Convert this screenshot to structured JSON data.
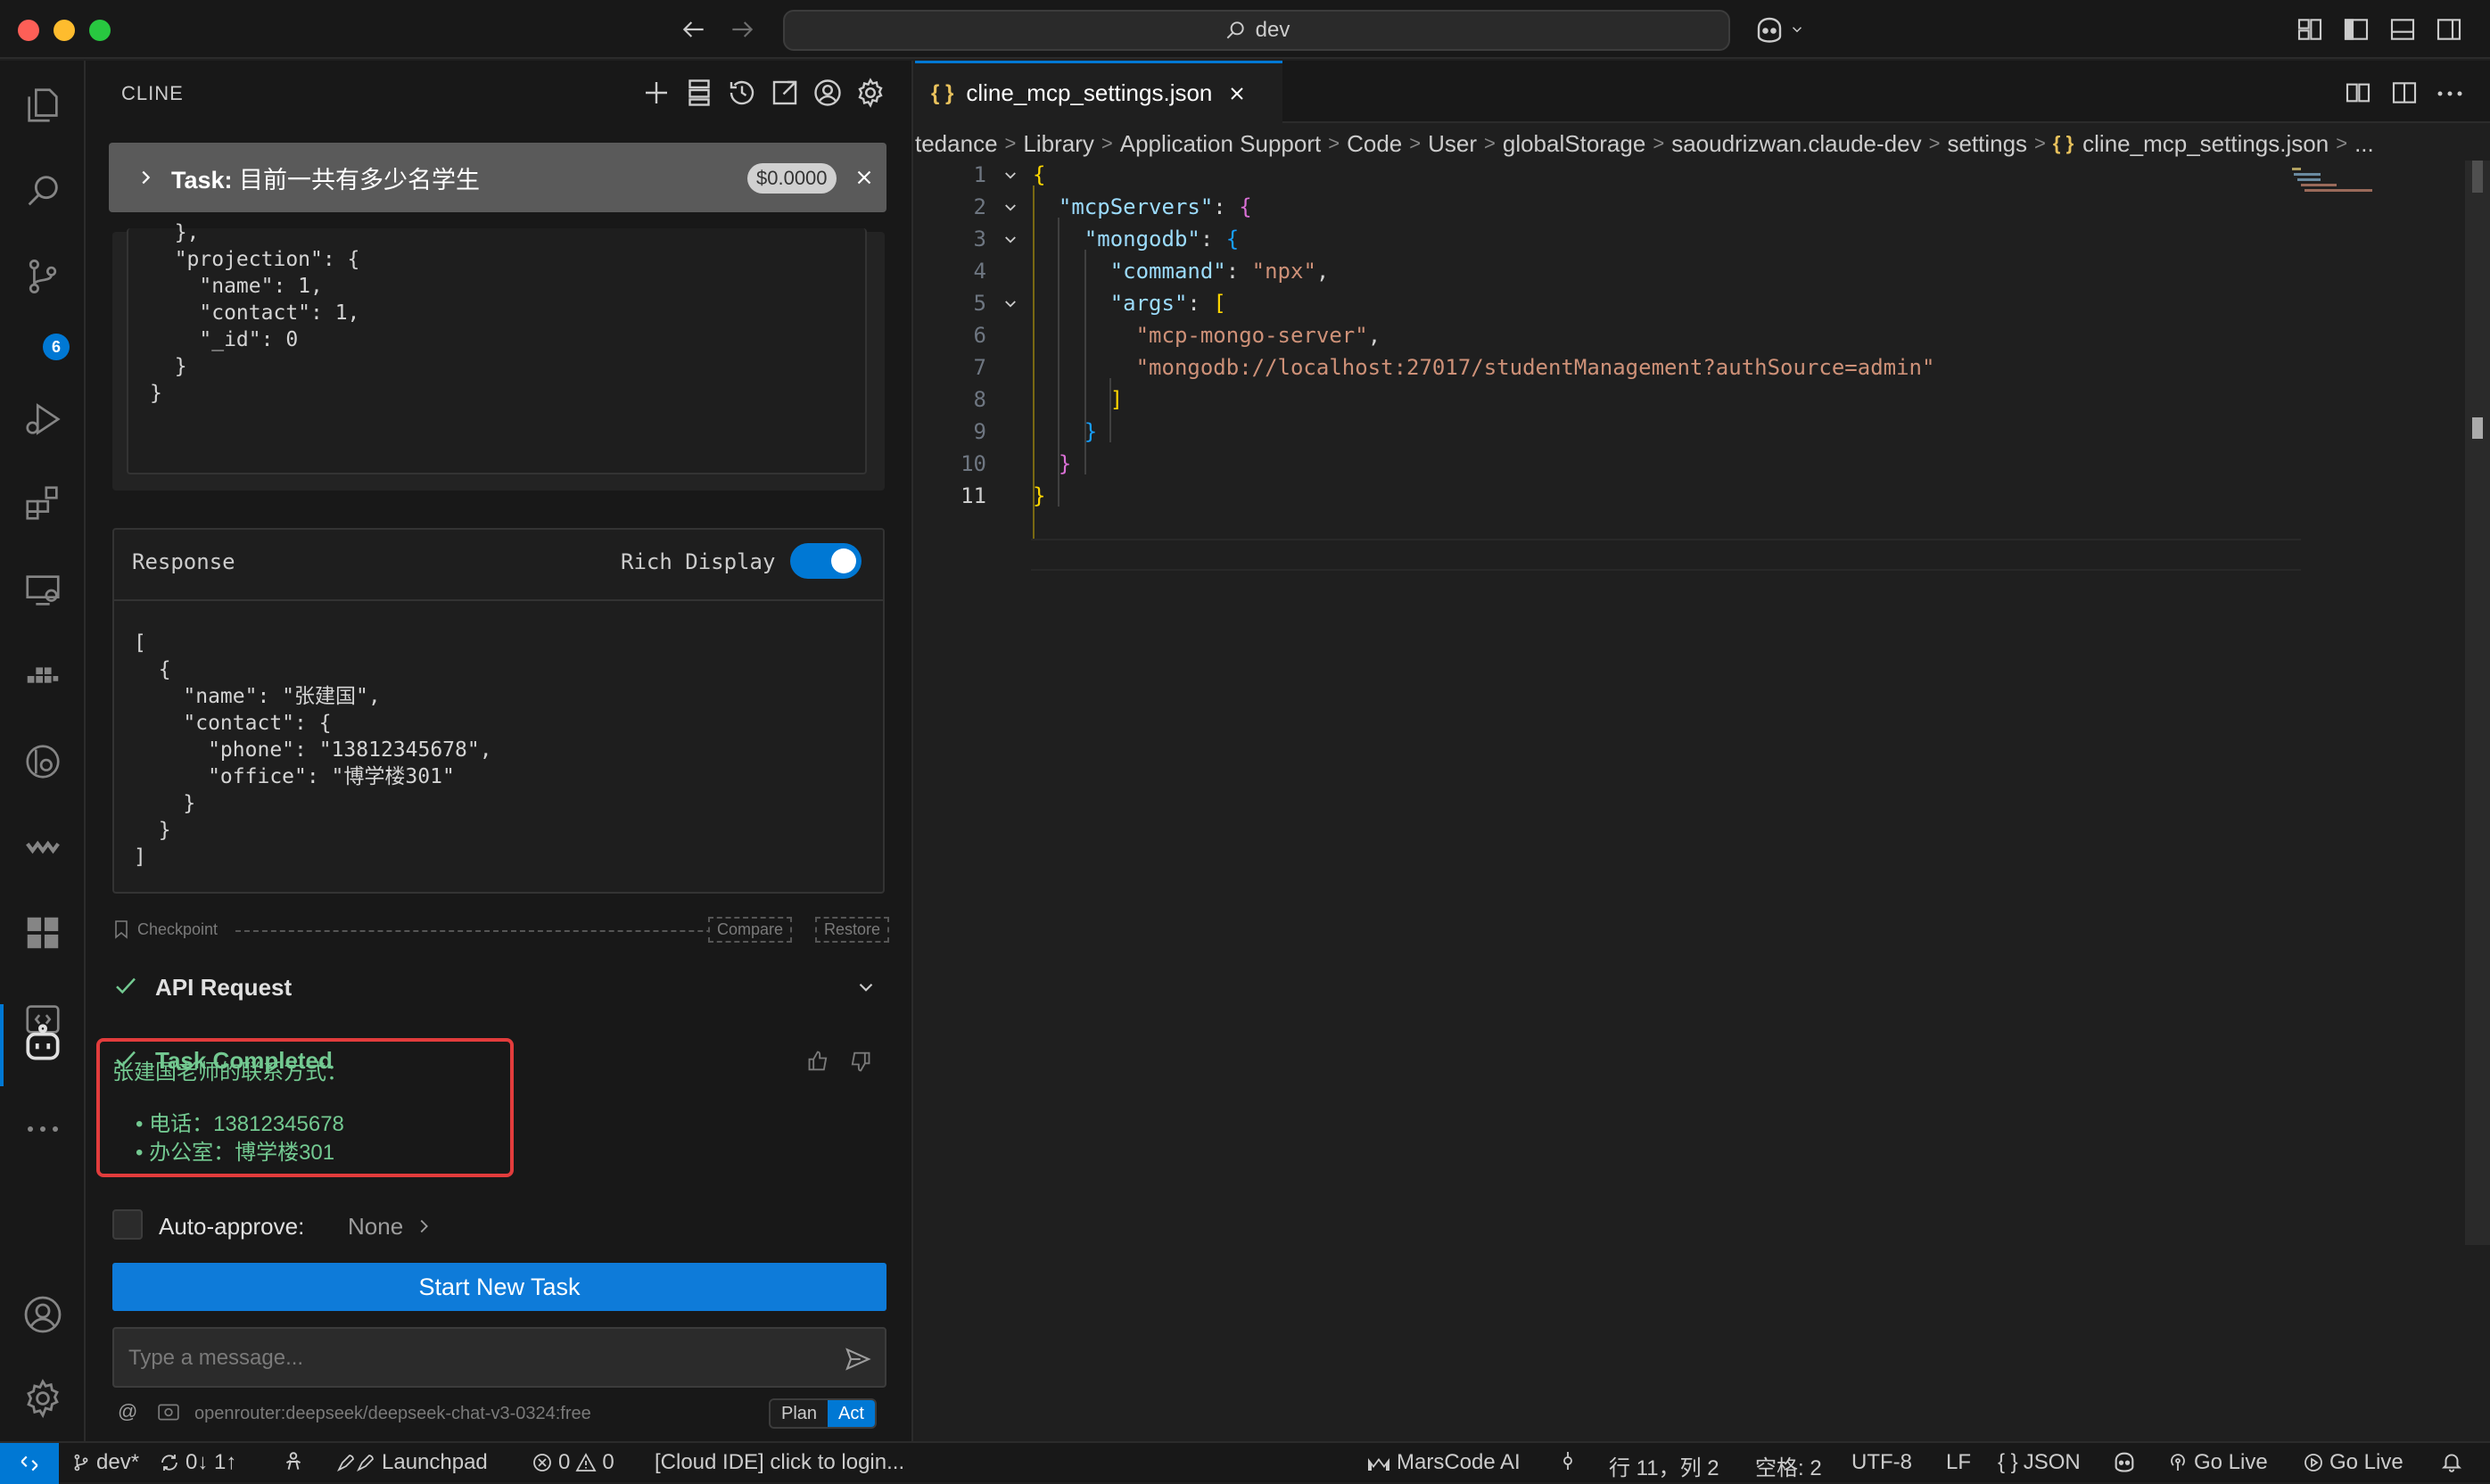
{
  "window": {
    "search_text": "dev"
  },
  "sidebar": {
    "title": "CLINE",
    "task": {
      "prefix": "Task:",
      "text": "目前一共有多少名学生",
      "cost": "$0.0000"
    },
    "request_code": "  },\n  \"projection\": {\n    \"name\": 1,\n    \"contact\": 1,\n    \"_id\": 0\n  }\n}",
    "response": {
      "label": "Response",
      "rich_display_label": "Rich Display",
      "rich_display_on": true,
      "code": "[\n  {\n    \"name\": \"张建国\",\n    \"contact\": {\n      \"phone\": \"13812345678\",\n      \"office\": \"博学楼301\"\n    }\n  }\n]"
    },
    "checkpoint": {
      "label": "Checkpoint",
      "compare": "Compare",
      "restore": "Restore"
    },
    "api_request": "API Request",
    "task_completed": "Task Completed",
    "answer": {
      "heading": "张建国老师的联系方式：",
      "items": [
        "电话：13812345678",
        "办公室：博学楼301"
      ]
    },
    "auto_approve": {
      "label": "Auto-approve:",
      "value": "None"
    },
    "start_new_task": "Start New Task",
    "message_placeholder": "Type a message...",
    "model": "openrouter:deepseek/deepseek-chat-v3-0324:free",
    "mode": {
      "plan": "Plan",
      "act": "Act",
      "active": "Act"
    }
  },
  "editor": {
    "tab_title": "cline_mcp_settings.json",
    "breadcrumbs": [
      "tedance",
      "Library",
      "Application Support",
      "Code",
      "User",
      "globalStorage",
      "saoudrizwan.claude-dev",
      "settings",
      "cline_mcp_settings.json",
      "..."
    ],
    "line_numbers": [
      "1",
      "2",
      "3",
      "4",
      "5",
      "6",
      "7",
      "8",
      "9",
      "10",
      "11"
    ],
    "current_line": 11,
    "json": {
      "root_key": "\"mcpServers\"",
      "server_key": "\"mongodb\"",
      "command_key": "\"command\"",
      "command_value": "\"npx\"",
      "args_key": "\"args\"",
      "arg1": "\"mcp-mongo-server\"",
      "arg2": "\"mongodb://localhost:27017/studentManagement?authSource=admin\""
    }
  },
  "statusbar": {
    "branch": "dev*",
    "sync": "0↓ 1↑",
    "launchpad": "Launchpad",
    "errors": "0",
    "warnings": "0",
    "cloud": "[Cloud IDE] click to login...",
    "marscode": "MarsCode AI",
    "position": "行 11，列 2",
    "spaces": "空格: 2",
    "encoding": "UTF-8",
    "eol": "LF",
    "language": "JSON",
    "golive1": "Go Live",
    "golive2": "Go Live"
  },
  "colors": {
    "accent": "#0078d4",
    "success": "#73c991",
    "highlight_border": "#e23c3c"
  }
}
